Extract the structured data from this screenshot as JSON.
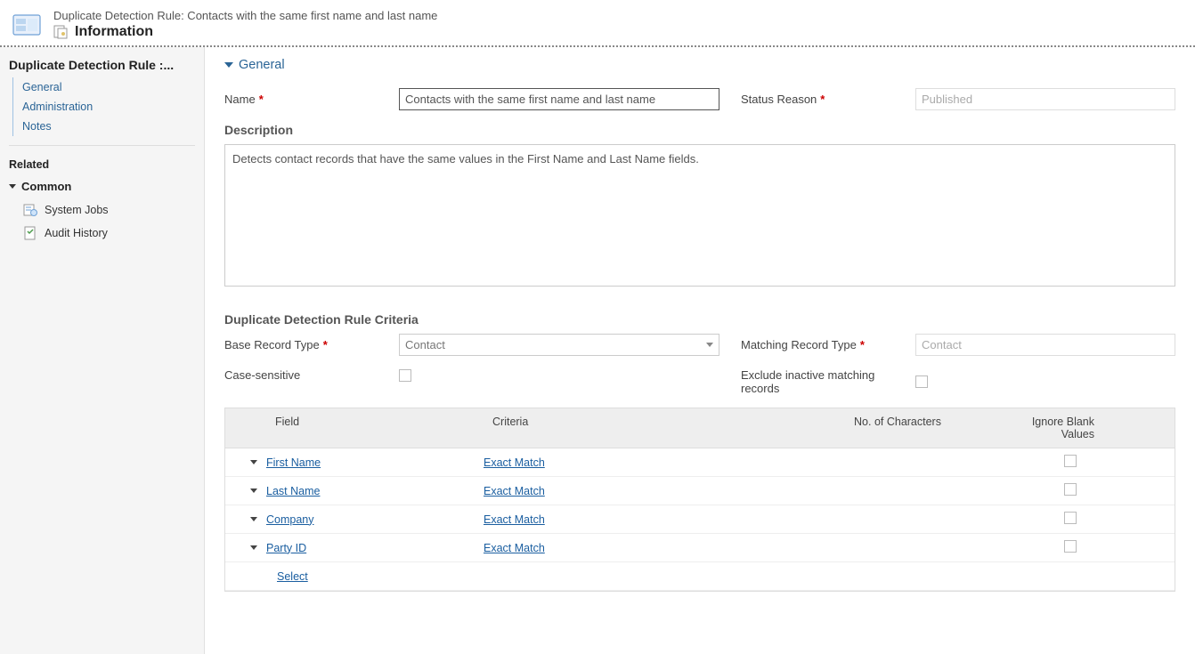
{
  "header": {
    "title": "Duplicate Detection Rule: Contacts with the same first name and last name",
    "page": "Information"
  },
  "sidebar": {
    "breadcrumb": "Duplicate Detection Rule :...",
    "nav": {
      "general": "General",
      "administration": "Administration",
      "notes": "Notes"
    },
    "related_label": "Related",
    "common_label": "Common",
    "common": {
      "system_jobs": "System Jobs",
      "audit_history": "Audit History"
    }
  },
  "general": {
    "section_label": "General",
    "name_label": "Name",
    "name_value": "Contacts with the same first name and last name",
    "status_label": "Status Reason",
    "status_value": "Published",
    "description_label": "Description",
    "description_value": "Detects contact records that have the same values in the First Name and Last Name fields."
  },
  "criteria": {
    "section_label": "Duplicate Detection Rule Criteria",
    "base_type_label": "Base Record Type",
    "base_type_value": "Contact",
    "matching_type_label": "Matching Record Type",
    "matching_type_value": "Contact",
    "case_sensitive_label": "Case-sensitive",
    "exclude_inactive_label": "Exclude inactive matching records",
    "headers": {
      "field": "Field",
      "criteria": "Criteria",
      "chars": "No. of Characters",
      "ignore": "Ignore Blank Values"
    },
    "rows": [
      {
        "field": "First Name",
        "criteria": "Exact Match"
      },
      {
        "field": "Last Name",
        "criteria": "Exact Match"
      },
      {
        "field": "Company",
        "criteria": "Exact Match"
      },
      {
        "field": "Party ID",
        "criteria": "Exact Match"
      }
    ],
    "select_label": "Select"
  }
}
